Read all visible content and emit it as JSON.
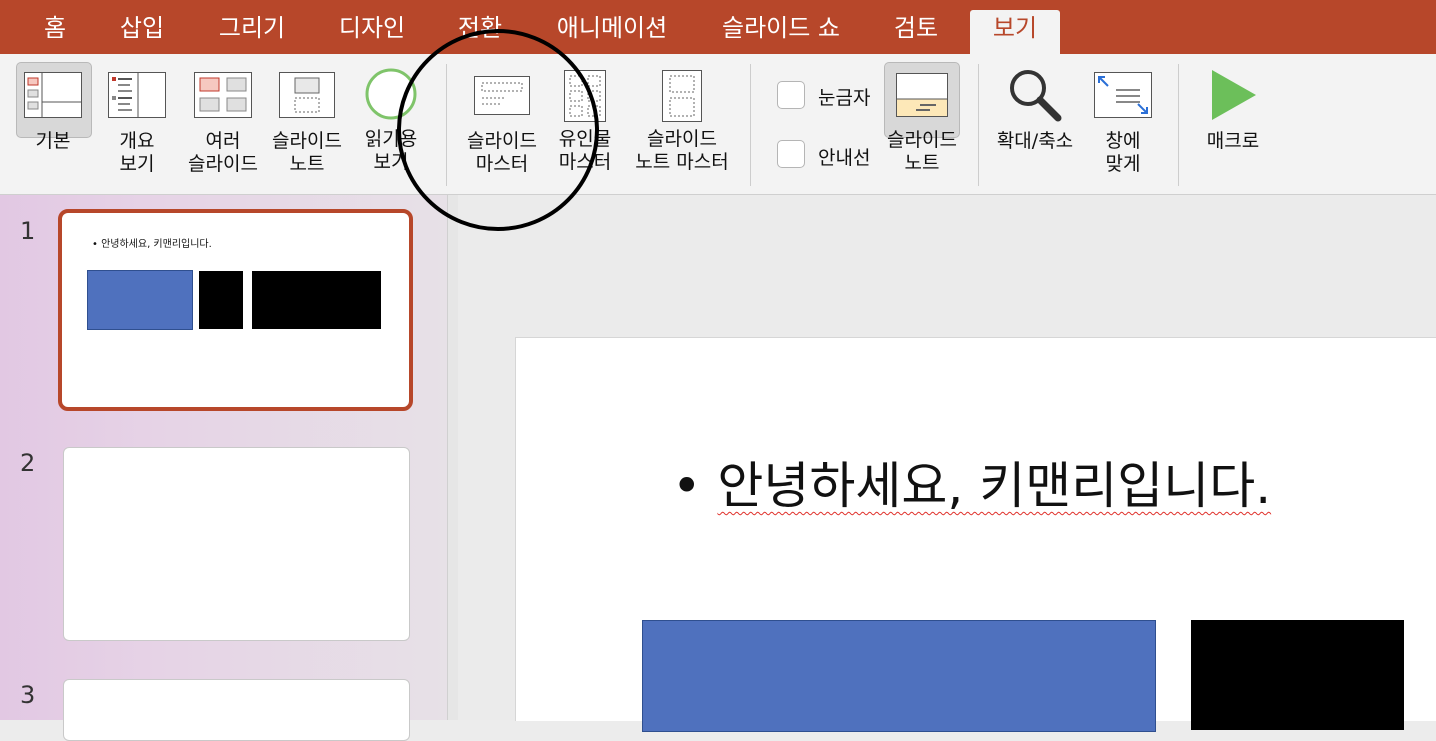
{
  "tabs": [
    {
      "label": "홈"
    },
    {
      "label": "삽입"
    },
    {
      "label": "그리기"
    },
    {
      "label": "디자인"
    },
    {
      "label": "전환"
    },
    {
      "label": "애니메이션"
    },
    {
      "label": "슬라이드 쇼"
    },
    {
      "label": "검토"
    },
    {
      "label": "보기"
    }
  ],
  "active_tab": "보기",
  "ribbon": {
    "normal": "기본",
    "outline": "개요\n보기",
    "slide_sorter": "여러\n슬라이드",
    "notes_page": "슬라이드\n노트",
    "reading_view": "읽기용\n보기",
    "slide_master": "슬라이드\n마스터",
    "handout_master": "유인물\n마스터",
    "notes_master": "슬라이드\n노트 마스터",
    "ruler": "눈금자",
    "guides": "안내선",
    "notes": "슬라이드\n노트",
    "zoom": "확대/축소",
    "fit_to_window": "창에\n맞게",
    "macros": "매크로"
  },
  "slides": [
    {
      "number": "1",
      "text": "• 안녕하세요, 키맨리입니다."
    },
    {
      "number": "2"
    },
    {
      "number": "3"
    }
  ],
  "main_slide": {
    "bullet": "•",
    "text": "안녕하세요, 키맨리입니다."
  },
  "colors": {
    "accent": "#b7472a",
    "shape_blue": "#4f71be",
    "shape_black": "#000000"
  }
}
